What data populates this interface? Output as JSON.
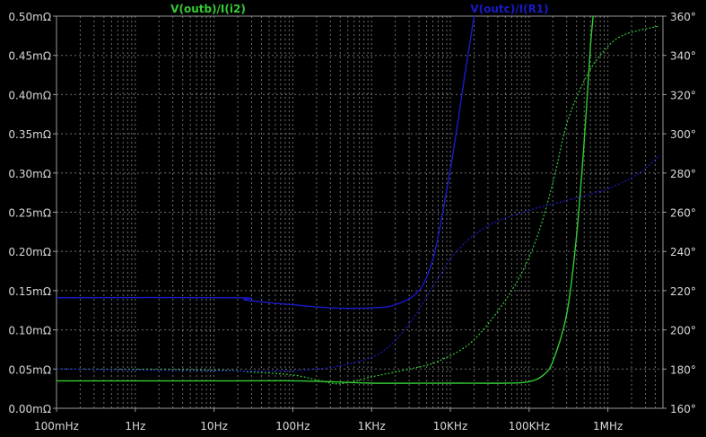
{
  "chart_data": {
    "type": "line",
    "title": "",
    "x_scale": "log",
    "x_range_hz": [
      0.1,
      5000000
    ],
    "x_ticks": [
      {
        "value": 0.1,
        "label": "100mHz"
      },
      {
        "value": 1,
        "label": "1Hz"
      },
      {
        "value": 10,
        "label": "10Hz"
      },
      {
        "value": 100,
        "label": "100Hz"
      },
      {
        "value": 1000,
        "label": "1KHz"
      },
      {
        "value": 10000,
        "label": "10KHz"
      },
      {
        "value": 100000,
        "label": "100KHz"
      },
      {
        "value": 1000000,
        "label": "1MHz"
      }
    ],
    "y_left": {
      "unit": "mΩ",
      "range": [
        0,
        0.5
      ],
      "ticks": [
        {
          "value": 0.5,
          "label": "0.50mΩ"
        },
        {
          "value": 0.45,
          "label": "0.45mΩ"
        },
        {
          "value": 0.4,
          "label": "0.40mΩ"
        },
        {
          "value": 0.35,
          "label": "0.35mΩ"
        },
        {
          "value": 0.3,
          "label": "0.30mΩ"
        },
        {
          "value": 0.25,
          "label": "0.25mΩ"
        },
        {
          "value": 0.2,
          "label": "0.20mΩ"
        },
        {
          "value": 0.15,
          "label": "0.15mΩ"
        },
        {
          "value": 0.1,
          "label": "0.10mΩ"
        },
        {
          "value": 0.05,
          "label": "0.05mΩ"
        },
        {
          "value": 0,
          "label": "0.00mΩ"
        }
      ]
    },
    "y_right": {
      "unit": "°",
      "range": [
        160,
        360
      ],
      "ticks": [
        {
          "value": 360,
          "label": "360°"
        },
        {
          "value": 340,
          "label": "340°"
        },
        {
          "value": 320,
          "label": "320°"
        },
        {
          "value": 300,
          "label": "300°"
        },
        {
          "value": 280,
          "label": "280°"
        },
        {
          "value": 260,
          "label": "260°"
        },
        {
          "value": 240,
          "label": "240°"
        },
        {
          "value": 220,
          "label": "220°"
        },
        {
          "value": 200,
          "label": "200°"
        },
        {
          "value": 180,
          "label": "180°"
        },
        {
          "value": 160,
          "label": "160°"
        }
      ]
    },
    "grid": true,
    "legend_position": "top-center",
    "series": [
      {
        "name": "V(outb)/I(i2)",
        "component": "magnitude",
        "axis": "left",
        "color": "#33cc33",
        "dash": "solid",
        "points": [
          [
            0.1,
            0.035
          ],
          [
            20,
            0.035
          ],
          [
            100,
            0.035
          ],
          [
            300,
            0.034
          ],
          [
            1000,
            0.032
          ],
          [
            10000,
            0.032
          ],
          [
            50000,
            0.032
          ],
          [
            100000,
            0.034
          ],
          [
            150000,
            0.042
          ],
          [
            200000,
            0.06
          ],
          [
            300000,
            0.12
          ],
          [
            400000,
            0.22
          ],
          [
            500000,
            0.34
          ],
          [
            600000,
            0.46
          ],
          [
            650000,
            0.5
          ]
        ]
      },
      {
        "name": "",
        "component": "phase",
        "axis": "right",
        "color": "#33cc33",
        "dash": "dotted",
        "points": [
          [
            0.1,
            180
          ],
          [
            10,
            179.5
          ],
          [
            30,
            178.5
          ],
          [
            100,
            177
          ],
          [
            200,
            174.5
          ],
          [
            400,
            172.5
          ],
          [
            1000,
            176
          ],
          [
            3000,
            180
          ],
          [
            7000,
            184
          ],
          [
            20000,
            195
          ],
          [
            60000,
            220
          ],
          [
            120000,
            245
          ],
          [
            200000,
            275
          ],
          [
            300000,
            305
          ],
          [
            500000,
            327
          ],
          [
            800000,
            340
          ],
          [
            1500000,
            350
          ],
          [
            4500000,
            355
          ]
        ]
      },
      {
        "name": "V(outc)/I(R1)",
        "component": "magnitude",
        "axis": "left",
        "color": "#1a1acc",
        "dash": "solid",
        "points": [
          [
            0.1,
            0.141
          ],
          [
            20,
            0.141
          ],
          [
            25,
            0.138
          ],
          [
            100,
            0.132
          ],
          [
            300,
            0.128
          ],
          [
            1000,
            0.128
          ],
          [
            2000,
            0.132
          ],
          [
            4000,
            0.15
          ],
          [
            6000,
            0.19
          ],
          [
            8000,
            0.25
          ],
          [
            11000,
            0.33
          ],
          [
            15000,
            0.42
          ],
          [
            20000,
            0.5
          ]
        ]
      },
      {
        "name": "",
        "component": "phase",
        "axis": "right",
        "color": "#1a1acc",
        "dash": "dotted",
        "points": [
          [
            0.1,
            180
          ],
          [
            30,
            179
          ],
          [
            200,
            180
          ],
          [
            700,
            184
          ],
          [
            1500,
            190
          ],
          [
            3000,
            203
          ],
          [
            6000,
            222
          ],
          [
            12000,
            240
          ],
          [
            30000,
            253
          ],
          [
            100000,
            261
          ],
          [
            300000,
            266
          ],
          [
            1000000,
            272
          ],
          [
            2500000,
            280
          ],
          [
            4500000,
            289
          ]
        ]
      }
    ]
  }
}
